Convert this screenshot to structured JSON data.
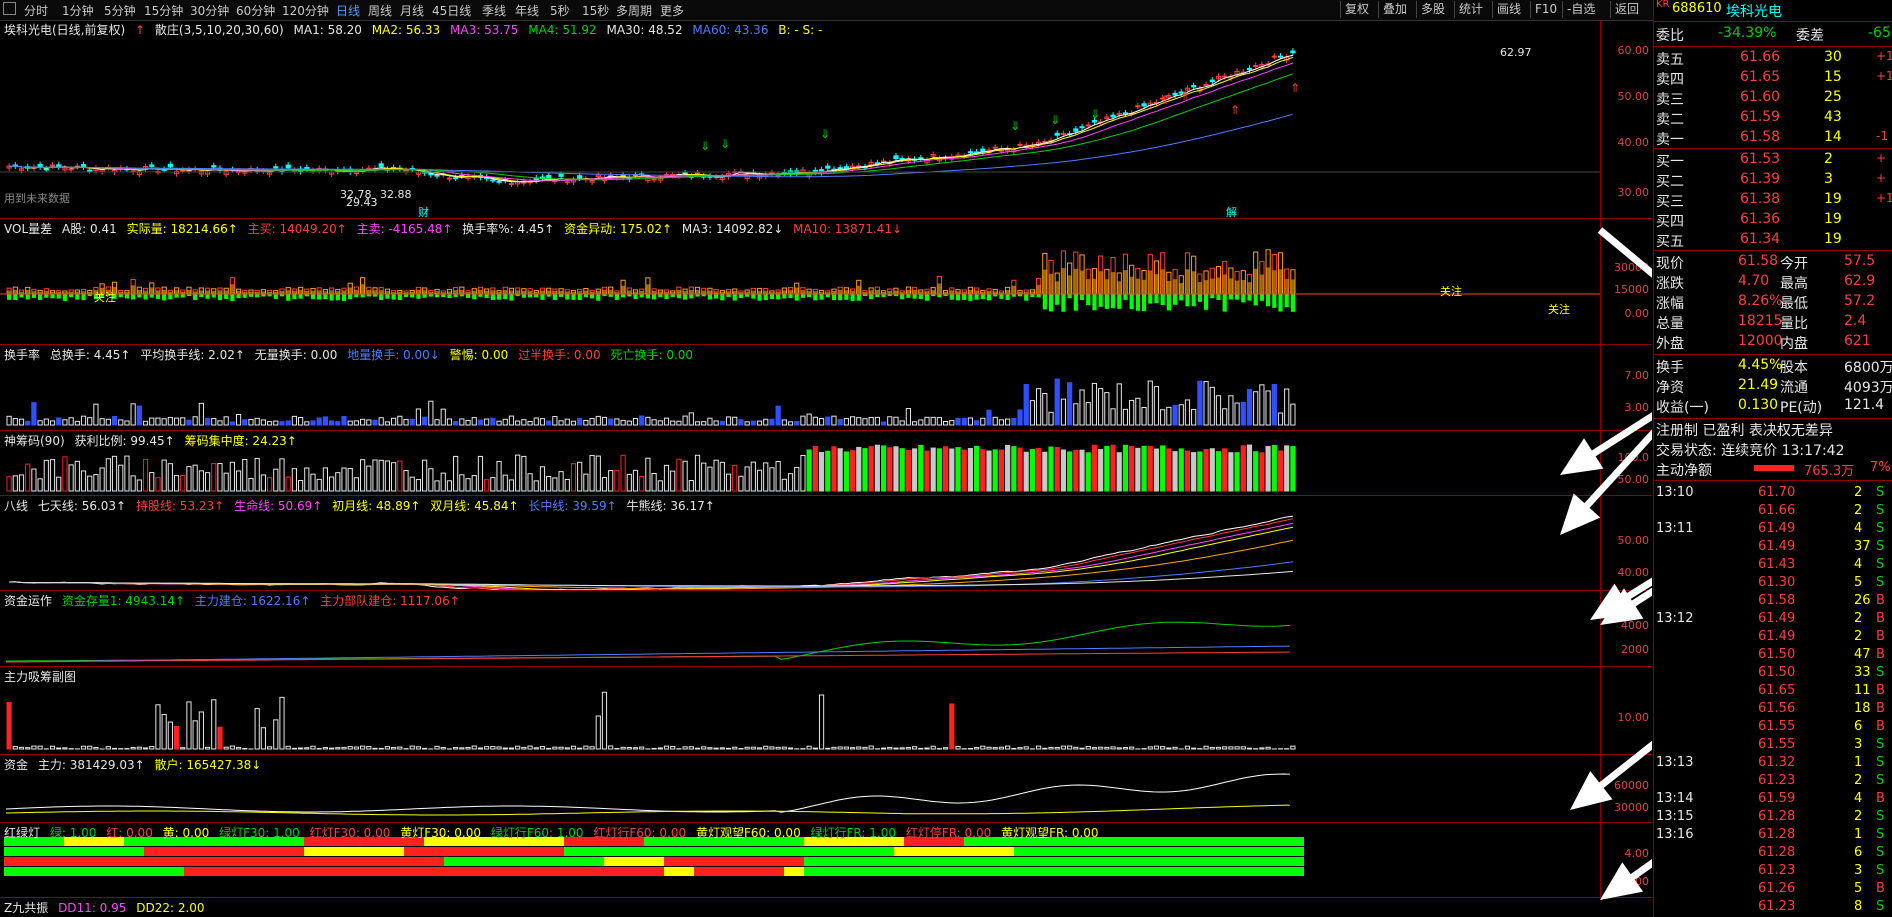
{
  "toolbar": {
    "timeframes": [
      "分时",
      "1分钟",
      "5分钟",
      "15分钟",
      "30分钟",
      "60分钟",
      "120分钟",
      "日线",
      "周线",
      "月线",
      "45日线",
      "季线",
      "年线",
      "5秒",
      "15秒",
      "多周期",
      "更多"
    ],
    "active_timeframe": "日线",
    "buttons": [
      "复权",
      "叠加",
      "多股",
      "统计",
      "画线",
      "F10",
      "-自选",
      "返回"
    ]
  },
  "main_panel": {
    "title": "埃科光电(日线,前复权)",
    "indicator": "散庄(3,5,10,20,30,60)",
    "ma1": "MA1: 58.20",
    "ma2": "MA2: 56.33",
    "ma3": "MA3: 53.75",
    "ma4": "MA4: 51.92",
    "ma30": "MA30: 48.52",
    "ma60": "MA60: 43.36",
    "bs": "B: - S: -",
    "high_label": "62.97",
    "low_label1": "32.78",
    "low_label2": "32.88",
    "low_label3": "29.43",
    "note": "用到未来数据",
    "mark1": "财",
    "mark2": "解",
    "ticks": [
      "60.00",
      "50.00",
      "40.00",
      "30.00"
    ]
  },
  "vol_panel": {
    "name": "VOL量差",
    "items": [
      "A股: 0.41",
      "实际量: 18214.66↑",
      "主买: 14049.20↑",
      "主卖: -4165.48↑",
      "换手率%: 4.45↑",
      "资金异动: 175.02↑",
      "MA3: 14092.82↓",
      "MA10: 13871.41↓"
    ],
    "ticks": [
      "30000",
      "15000",
      "0.00"
    ],
    "focus_label": "关注"
  },
  "turnover_panel": {
    "name": "换手率",
    "items": [
      "总换手: 4.45↑",
      "平均换手线: 2.02↑",
      "无量换手: 0.00",
      "地量换手: 0.00↓",
      "警惕: 0.00",
      "过半换手: 0.00",
      "死亡换手: 0.00"
    ],
    "ticks": [
      "7.00",
      "3.00"
    ]
  },
  "chip_panel": {
    "name": "神筹码(90)",
    "items": [
      "获利比例: 99.45↑",
      "筹码集中度: 24.23↑"
    ],
    "ticks": [
      "100.0",
      "50.00"
    ]
  },
  "eight_panel": {
    "name": "八线",
    "items": [
      "七天线: 56.03↑",
      "持股线: 53.23↑",
      "生命线: 50.69↑",
      "初月线: 48.89↑",
      "双月线: 45.84↑",
      "长中线: 39.59↑",
      "牛熊线: 36.17↑"
    ],
    "ticks": [
      "50.00",
      "40.00"
    ]
  },
  "fund_panel": {
    "name": "资金运作",
    "items": [
      "资金存量1: 4943.14↑",
      "主力建仓: 1622.16↑",
      "主力部队建仓: 1117.06↑"
    ],
    "ticks": [
      "4000",
      "2000"
    ]
  },
  "absorb_panel": {
    "name": "主力吸筹副图",
    "ticks": [
      "10.00"
    ]
  },
  "capital_panel": {
    "name": "资金",
    "items": [
      "主力: 381429.03↑",
      "散户: 165427.38↓"
    ],
    "ticks": [
      "60000",
      "30000"
    ]
  },
  "light_panel": {
    "name": "红绿灯",
    "items": [
      "绿: 1.00",
      "红: 0.00",
      "黄: 0.00",
      "绿灯F30: 1.00",
      "红灯F30: 0.00",
      "黄灯F30: 0.00",
      "绿灯行F60: 1.00",
      "红灯行F60: 0.00",
      "黄灯观望F60: 0.00",
      "绿灯行FR: 1.00",
      "红灯停FR: 0.00",
      "黄灯观望FR: 0.00"
    ],
    "ticks": [
      "4.00",
      "2.00"
    ]
  },
  "z9_panel": {
    "name": "Z九共振",
    "items": [
      "DD11: 0.95",
      "DD22: 2.00"
    ]
  },
  "sidebar": {
    "code": "688610",
    "name": "埃科光电",
    "badge": "KR",
    "weibi_label": "委比",
    "weibi_value": "-34.39%",
    "weicha_label": "委差",
    "weicha_value": "-65",
    "asks": [
      {
        "label": "卖五",
        "price": "61.66",
        "vol": "30",
        "chg": "+1"
      },
      {
        "label": "卖四",
        "price": "61.65",
        "vol": "15",
        "chg": "+1"
      },
      {
        "label": "卖三",
        "price": "61.60",
        "vol": "25",
        "chg": ""
      },
      {
        "label": "卖二",
        "price": "61.59",
        "vol": "43",
        "chg": ""
      },
      {
        "label": "卖一",
        "price": "61.58",
        "vol": "14",
        "chg": "-1"
      }
    ],
    "bids": [
      {
        "label": "买一",
        "price": "61.53",
        "vol": "2",
        "chg": "+"
      },
      {
        "label": "买二",
        "price": "61.39",
        "vol": "3",
        "chg": "+"
      },
      {
        "label": "买三",
        "price": "61.38",
        "vol": "19",
        "chg": "+1"
      },
      {
        "label": "买四",
        "price": "61.36",
        "vol": "19",
        "chg": ""
      },
      {
        "label": "买五",
        "price": "61.34",
        "vol": "19",
        "chg": ""
      }
    ],
    "stats": [
      {
        "l1": "现价",
        "v1": "61.58",
        "l2": "今开",
        "v2": "57.5"
      },
      {
        "l1": "涨跌",
        "v1": "4.70",
        "l2": "最高",
        "v2": "62.9"
      },
      {
        "l1": "涨幅",
        "v1": "8.26%",
        "l2": "最低",
        "v2": "57.2"
      },
      {
        "l1": "总量",
        "v1": "18215",
        "l2": "量比",
        "v2": "2.4"
      },
      {
        "l1": "外盘",
        "v1": "12000",
        "l2": "内盘",
        "v2": "621"
      }
    ],
    "stats2": [
      {
        "l1": "换手",
        "v1": "4.45%",
        "l2": "股本",
        "v2": "6800万"
      },
      {
        "l1": "净资",
        "v1": "21.49",
        "l2": "流通",
        "v2": "4093万"
      },
      {
        "l1": "收益(一)",
        "v1": "0.130",
        "l2": "PE(动)",
        "v2": "121.4"
      }
    ],
    "reg_text": "注册制 已盈利 表决权无差异",
    "trade_status": "交易状态: 连续竞价 13:17:42",
    "net_label": "主动净额",
    "net_value": "765.3万",
    "net_pct": "7%",
    "ticks": [
      {
        "time": "13:10",
        "price": "61.70",
        "vol": "2",
        "bs": "S"
      },
      {
        "time": "",
        "price": "61.66",
        "vol": "2",
        "bs": "S"
      },
      {
        "time": "13:11",
        "price": "61.49",
        "vol": "4",
        "bs": "S"
      },
      {
        "time": "",
        "price": "61.49",
        "vol": "37",
        "bs": "S"
      },
      {
        "time": "",
        "price": "61.43",
        "vol": "4",
        "bs": "S"
      },
      {
        "time": "",
        "price": "61.30",
        "vol": "5",
        "bs": "S"
      },
      {
        "time": "",
        "price": "61.58",
        "vol": "26",
        "bs": "B"
      },
      {
        "time": "13:12",
        "price": "61.49",
        "vol": "2",
        "bs": "B"
      },
      {
        "time": "",
        "price": "61.49",
        "vol": "2",
        "bs": "B"
      },
      {
        "time": "",
        "price": "61.50",
        "vol": "47",
        "bs": "B"
      },
      {
        "time": "",
        "price": "61.50",
        "vol": "33",
        "bs": "S"
      },
      {
        "time": "",
        "price": "61.65",
        "vol": "11",
        "bs": "B"
      },
      {
        "time": "",
        "price": "61.56",
        "vol": "18",
        "bs": "B"
      },
      {
        "time": "",
        "price": "61.55",
        "vol": "6",
        "bs": "B"
      },
      {
        "time": "",
        "price": "61.55",
        "vol": "3",
        "bs": "S"
      },
      {
        "time": "13:13",
        "price": "61.32",
        "vol": "1",
        "bs": "S"
      },
      {
        "time": "",
        "price": "61.23",
        "vol": "2",
        "bs": "S"
      },
      {
        "time": "13:14",
        "price": "61.59",
        "vol": "4",
        "bs": "B"
      },
      {
        "time": "13:15",
        "price": "61.28",
        "vol": "2",
        "bs": "S"
      },
      {
        "time": "13:16",
        "price": "61.28",
        "vol": "1",
        "bs": "S"
      },
      {
        "time": "",
        "price": "61.28",
        "vol": "6",
        "bs": "S"
      },
      {
        "time": "",
        "price": "61.23",
        "vol": "3",
        "bs": "S"
      },
      {
        "time": "",
        "price": "61.26",
        "vol": "5",
        "bs": "B"
      },
      {
        "time": "",
        "price": "61.23",
        "vol": "8",
        "bs": "S"
      }
    ]
  }
}
